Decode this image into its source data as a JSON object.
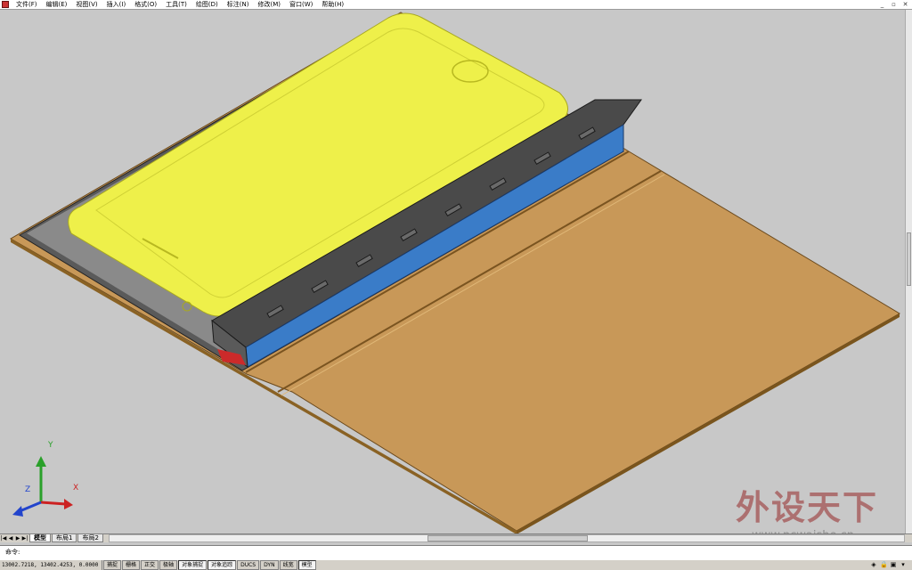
{
  "menubar": {
    "items": [
      "文件(F)",
      "编辑(E)",
      "视图(V)",
      "插入(I)",
      "格式(O)",
      "工具(T)",
      "绘图(D)",
      "标注(N)",
      "修改(M)",
      "窗口(W)",
      "帮助(H)"
    ]
  },
  "window_controls": {
    "minimize": "_",
    "restore": "▫",
    "close": "✕"
  },
  "ucs_icon": {
    "x_label": "X",
    "y_label": "Y",
    "z_label": "Z"
  },
  "layout_tabs": [
    "模型",
    "布局1",
    "布局2"
  ],
  "command": {
    "prompt": "命令:",
    "value": ""
  },
  "status": {
    "coords": "13002.7218, 13402.4253, 0.0000",
    "buttons": [
      "捕捉",
      "栅格",
      "正交",
      "极轴",
      "对象捕捉",
      "对象追踪",
      "DUCS",
      "DYN",
      "线宽",
      "模型"
    ]
  },
  "watermark": {
    "main": "外设天下",
    "sub": "www.pcwaishe.cn"
  },
  "colors": {
    "viewport_bg": "#c8c8c8",
    "phone_yellow": "#eef04a",
    "case_wood": "#c89858",
    "keyboard_blue": "#3a7cc8",
    "keyboard_dark": "#4a4a4a",
    "accent_red": "#cc2a2a"
  }
}
